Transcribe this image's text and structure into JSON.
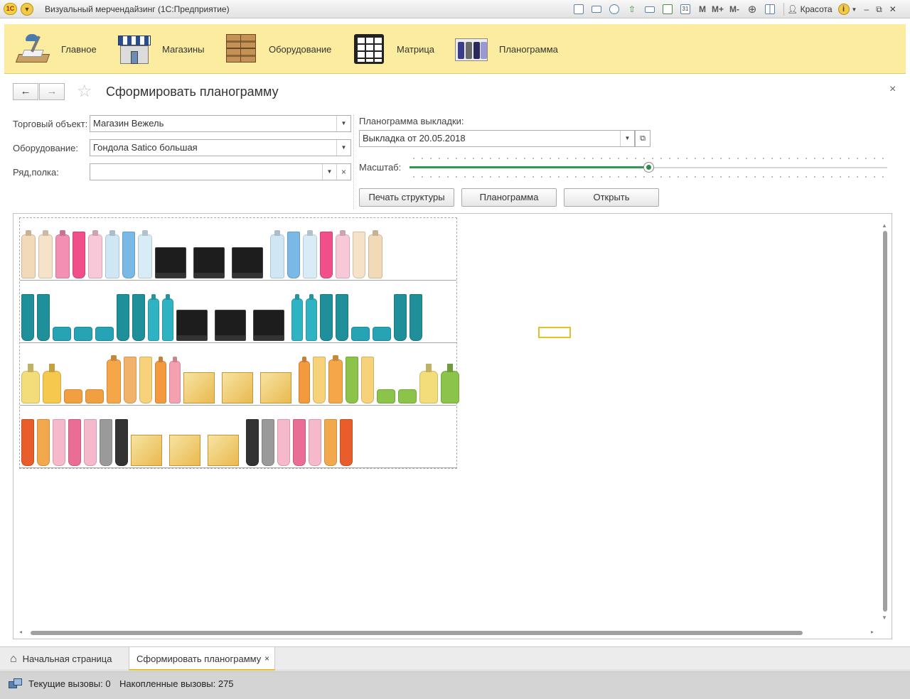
{
  "window": {
    "title": "Визуальный мерчендайзинг (1С:Предприятие)",
    "logo": "1С",
    "user": "Красота",
    "memory_buttons": [
      "M",
      "M+",
      "M-"
    ],
    "icons": [
      "save-icon",
      "print-icon",
      "preview-icon",
      "export-icon",
      "scanner-icon",
      "calculator-icon",
      "calendar-icon",
      "zoom-icon",
      "layout-icon",
      "info-icon",
      "minimize-icon",
      "restore-icon",
      "close-icon"
    ]
  },
  "sections": [
    {
      "label": "Главное",
      "icon": "desk-lamp-icon"
    },
    {
      "label": "Магазины",
      "icon": "store-icon"
    },
    {
      "label": "Оборудование",
      "icon": "crates-icon"
    },
    {
      "label": "Матрица",
      "icon": "matrix-grid-icon"
    },
    {
      "label": "Планограмма",
      "icon": "planogram-icon"
    }
  ],
  "form": {
    "title": "Сформировать планограмму",
    "back_icon": "←",
    "forward_icon": "→",
    "star_icon": "☆",
    "close_icon": "×",
    "fields": {
      "trade_object_label": "Торговый объект:",
      "trade_object_value": "Магазин Вежель",
      "equipment_label": "Оборудование:",
      "equipment_value": "Гондола Satico большая",
      "row_shelf_label": "Ряд,полка:",
      "row_shelf_value": "",
      "planogram_label": "Планограмма выкладки:",
      "planogram_value": "Выкладка от 20.05.2018",
      "scale_label": "Масштаб:",
      "scale_fraction": 0.5
    },
    "buttons": {
      "print_structure": "Печать структуры",
      "planogram": "Планограмма",
      "open": "Открыть"
    }
  },
  "planogram_shelves": [
    {
      "items": [
        "bottle:#f2d9b8",
        "bottle:#f6e1c9",
        "bottle:#f38fb2",
        "tube:#f04f8a",
        "bottle:#f8c7d8",
        "bottle:#cfe6f5",
        "tube:#7ab8e5",
        "bottle:#d8ecf7",
        "box:dark",
        "box:dark",
        "box:dark",
        "bottle:#cfe6f5",
        "tube:#7ab8e5",
        "bottle:#d8ecf7",
        "tube:#f04f8a",
        "bottle:#f8c7d8",
        "tube:#f6e1c9",
        "bottle:#f2d9b8"
      ]
    },
    {
      "items": [
        "tube:#1f8f9a",
        "tube:#1f8f9a",
        "jar:#26a3b5",
        "jar:#26a3b5",
        "jar:#26a3b5",
        "tube:#1f8f9a",
        "tube:#1f8f9a",
        "spray:#2fb3c2",
        "spray:#2fb3c2",
        "box:dark",
        "box:dark",
        "box:dark",
        "spray:#2fb3c2",
        "spray:#2fb3c2",
        "tube:#1f8f9a",
        "tube:#1f8f9a",
        "jar:#26a3b5",
        "jar:#26a3b5",
        "tube:#1f8f9a",
        "tube:#1f8f9a"
      ]
    },
    {
      "items": [
        "pump:#f3dd7a",
        "pump:#f6c94e",
        "jar:#f0a040",
        "jar:#f0a040",
        "bottle:#f4a648",
        "tube:#f1b36a",
        "tube:#f7d27a",
        "spray:#f49a3e",
        "spray:#f4a0b0",
        "box:gold",
        "box:gold",
        "box:gold",
        "spray:#f49a3e",
        "tube:#f7d27a",
        "bottle:#f4a648",
        "tube:#8cc34a",
        "tube:#f7d27a",
        "jar:#8cc34a",
        "jar:#8cc34a",
        "pump:#f3dd7a",
        "pump:#8cc34a"
      ]
    },
    {
      "items": [
        "tube:#e85d2a",
        "tube:#f2a94d",
        "tube:#f5b9cb",
        "tube:#ea6d96",
        "tube:#f5b9cb",
        "tube:#9a9a9a",
        "tube:#333333",
        "box:gold",
        "box:gold",
        "box:gold",
        "tube:#333333",
        "tube:#9a9a9a",
        "tube:#f5b9cb",
        "tube:#ea6d96",
        "tube:#f5b9cb",
        "tube:#f2a94d",
        "tube:#e85d2a"
      ]
    }
  ],
  "tabs": {
    "home": "Начальная страница",
    "active": "Сформировать планограмму",
    "home_icon": "⌂",
    "close_icon": "×"
  },
  "status": {
    "current_calls": "Текущие вызовы: 0",
    "accumulated_calls": "Накопленные вызовы: 275"
  }
}
